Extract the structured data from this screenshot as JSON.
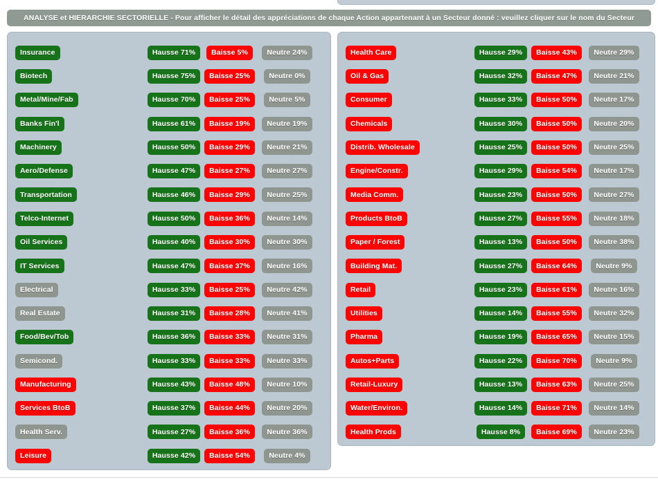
{
  "header": {
    "banner_text": "ANALYSE et HIERARCHIE SECTORIELLE - Pour afficher le détail des appréciations de chaque Action appartenant à un Secteur donné : veuillez cliquer sur le nom du Secteur"
  },
  "colors": {
    "green": "#17731a",
    "red": "#fc0404",
    "gray": "#8f9690",
    "panel_bg": "#bcc8d2",
    "header_bg": "#8e9a92",
    "page_bg": "#ffffff"
  },
  "legend": {
    "hausse_prefix": "Hausse",
    "baisse_prefix": "Baisse",
    "neutre_prefix": "Neutre"
  },
  "left_panel": {
    "rows": [
      {
        "sector": "Insurance",
        "sector_color": "green",
        "hausse": "Hausse 71%",
        "baisse": "Baisse 5%",
        "neutre": "Neutre 24%",
        "hausse_pct": 71,
        "baisse_pct": 5,
        "neutre_pct": 24
      },
      {
        "sector": "Biotech",
        "sector_color": "green",
        "hausse": "Hausse 75%",
        "baisse": "Baisse 25%",
        "neutre": "Neutre 0%",
        "hausse_pct": 75,
        "baisse_pct": 25,
        "neutre_pct": 0
      },
      {
        "sector": "Metal/Mine/Fab",
        "sector_color": "green",
        "hausse": "Hausse 70%",
        "baisse": "Baisse 25%",
        "neutre": "Neutre 5%",
        "hausse_pct": 70,
        "baisse_pct": 25,
        "neutre_pct": 5
      },
      {
        "sector": "Banks Fin'l",
        "sector_color": "green",
        "hausse": "Hausse 61%",
        "baisse": "Baisse 19%",
        "neutre": "Neutre 19%",
        "hausse_pct": 61,
        "baisse_pct": 19,
        "neutre_pct": 19
      },
      {
        "sector": "Machinery",
        "sector_color": "green",
        "hausse": "Hausse 50%",
        "baisse": "Baisse 29%",
        "neutre": "Neutre 21%",
        "hausse_pct": 50,
        "baisse_pct": 29,
        "neutre_pct": 21
      },
      {
        "sector": "Aero/Defense",
        "sector_color": "green",
        "hausse": "Hausse 47%",
        "baisse": "Baisse 27%",
        "neutre": "Neutre 27%",
        "hausse_pct": 47,
        "baisse_pct": 27,
        "neutre_pct": 27
      },
      {
        "sector": "Transportation",
        "sector_color": "green",
        "hausse": "Hausse 46%",
        "baisse": "Baisse 29%",
        "neutre": "Neutre 25%",
        "hausse_pct": 46,
        "baisse_pct": 29,
        "neutre_pct": 25
      },
      {
        "sector": "Telco-Internet",
        "sector_color": "green",
        "hausse": "Hausse 50%",
        "baisse": "Baisse 36%",
        "neutre": "Neutre 14%",
        "hausse_pct": 50,
        "baisse_pct": 36,
        "neutre_pct": 14
      },
      {
        "sector": "Oil Services",
        "sector_color": "green",
        "hausse": "Hausse 40%",
        "baisse": "Baisse 30%",
        "neutre": "Neutre 30%",
        "hausse_pct": 40,
        "baisse_pct": 30,
        "neutre_pct": 30
      },
      {
        "sector": "IT Services",
        "sector_color": "green",
        "hausse": "Hausse 47%",
        "baisse": "Baisse 37%",
        "neutre": "Neutre 16%",
        "hausse_pct": 47,
        "baisse_pct": 37,
        "neutre_pct": 16
      },
      {
        "sector": "Electrical",
        "sector_color": "gray",
        "hausse": "Hausse 33%",
        "baisse": "Baisse 25%",
        "neutre": "Neutre 42%",
        "hausse_pct": 33,
        "baisse_pct": 25,
        "neutre_pct": 42
      },
      {
        "sector": "Real Estate",
        "sector_color": "gray",
        "hausse": "Hausse 31%",
        "baisse": "Baisse 28%",
        "neutre": "Neutre 41%",
        "hausse_pct": 31,
        "baisse_pct": 28,
        "neutre_pct": 41
      },
      {
        "sector": "Food/Bev/Tob",
        "sector_color": "green",
        "hausse": "Hausse 36%",
        "baisse": "Baisse 33%",
        "neutre": "Neutre 31%",
        "hausse_pct": 36,
        "baisse_pct": 33,
        "neutre_pct": 31
      },
      {
        "sector": "Semicond.",
        "sector_color": "gray",
        "hausse": "Hausse 33%",
        "baisse": "Baisse 33%",
        "neutre": "Neutre 33%",
        "hausse_pct": 33,
        "baisse_pct": 33,
        "neutre_pct": 33
      },
      {
        "sector": "Manufacturing",
        "sector_color": "red",
        "hausse": "Hausse 43%",
        "baisse": "Baisse 48%",
        "neutre": "Neutre 10%",
        "hausse_pct": 43,
        "baisse_pct": 48,
        "neutre_pct": 10
      },
      {
        "sector": "Services BtoB",
        "sector_color": "red",
        "hausse": "Hausse 37%",
        "baisse": "Baisse 44%",
        "neutre": "Neutre 20%",
        "hausse_pct": 37,
        "baisse_pct": 44,
        "neutre_pct": 20
      },
      {
        "sector": "Health Serv.",
        "sector_color": "gray",
        "hausse": "Hausse 27%",
        "baisse": "Baisse 36%",
        "neutre": "Neutre 36%",
        "hausse_pct": 27,
        "baisse_pct": 36,
        "neutre_pct": 36
      },
      {
        "sector": "Leisure",
        "sector_color": "red",
        "hausse": "Hausse 42%",
        "baisse": "Baisse 54%",
        "neutre": "Neutre 4%",
        "hausse_pct": 42,
        "baisse_pct": 54,
        "neutre_pct": 4
      }
    ]
  },
  "right_panel": {
    "rows": [
      {
        "sector": "Health Care",
        "sector_color": "red",
        "hausse": "Hausse 29%",
        "baisse": "Baisse 43%",
        "neutre": "Neutre 29%",
        "hausse_pct": 29,
        "baisse_pct": 43,
        "neutre_pct": 29
      },
      {
        "sector": "Oil & Gas",
        "sector_color": "red",
        "hausse": "Hausse 32%",
        "baisse": "Baisse 47%",
        "neutre": "Neutre 21%",
        "hausse_pct": 32,
        "baisse_pct": 47,
        "neutre_pct": 21
      },
      {
        "sector": "Consumer",
        "sector_color": "red",
        "hausse": "Hausse 33%",
        "baisse": "Baisse 50%",
        "neutre": "Neutre 17%",
        "hausse_pct": 33,
        "baisse_pct": 50,
        "neutre_pct": 17
      },
      {
        "sector": "Chemicals",
        "sector_color": "red",
        "hausse": "Hausse 30%",
        "baisse": "Baisse 50%",
        "neutre": "Neutre 20%",
        "hausse_pct": 30,
        "baisse_pct": 50,
        "neutre_pct": 20
      },
      {
        "sector": "Distrib. Wholesale",
        "sector_color": "red",
        "hausse": "Hausse 25%",
        "baisse": "Baisse 50%",
        "neutre": "Neutre 25%",
        "hausse_pct": 25,
        "baisse_pct": 50,
        "neutre_pct": 25
      },
      {
        "sector": "Engine/Constr.",
        "sector_color": "red",
        "hausse": "Hausse 29%",
        "baisse": "Baisse 54%",
        "neutre": "Neutre 17%",
        "hausse_pct": 29,
        "baisse_pct": 54,
        "neutre_pct": 17
      },
      {
        "sector": "Media Comm.",
        "sector_color": "red",
        "hausse": "Hausse 23%",
        "baisse": "Baisse 50%",
        "neutre": "Neutre 27%",
        "hausse_pct": 23,
        "baisse_pct": 50,
        "neutre_pct": 27
      },
      {
        "sector": "Products BtoB",
        "sector_color": "red",
        "hausse": "Hausse 27%",
        "baisse": "Baisse 55%",
        "neutre": "Neutre 18%",
        "hausse_pct": 27,
        "baisse_pct": 55,
        "neutre_pct": 18
      },
      {
        "sector": "Paper / Forest",
        "sector_color": "red",
        "hausse": "Hausse 13%",
        "baisse": "Baisse 50%",
        "neutre": "Neutre 38%",
        "hausse_pct": 13,
        "baisse_pct": 50,
        "neutre_pct": 38
      },
      {
        "sector": "Building Mat.",
        "sector_color": "red",
        "hausse": "Hausse 27%",
        "baisse": "Baisse 64%",
        "neutre": "Neutre 9%",
        "hausse_pct": 27,
        "baisse_pct": 64,
        "neutre_pct": 9
      },
      {
        "sector": "Retail",
        "sector_color": "red",
        "hausse": "Hausse 23%",
        "baisse": "Baisse 61%",
        "neutre": "Neutre 16%",
        "hausse_pct": 23,
        "baisse_pct": 61,
        "neutre_pct": 16
      },
      {
        "sector": "Utilities",
        "sector_color": "red",
        "hausse": "Hausse 14%",
        "baisse": "Baisse 55%",
        "neutre": "Neutre 32%",
        "hausse_pct": 14,
        "baisse_pct": 55,
        "neutre_pct": 32
      },
      {
        "sector": "Pharma",
        "sector_color": "red",
        "hausse": "Hausse 19%",
        "baisse": "Baisse 65%",
        "neutre": "Neutre 15%",
        "hausse_pct": 19,
        "baisse_pct": 65,
        "neutre_pct": 15
      },
      {
        "sector": "Autos+Parts",
        "sector_color": "red",
        "hausse": "Hausse 22%",
        "baisse": "Baisse 70%",
        "neutre": "Neutre 9%",
        "hausse_pct": 22,
        "baisse_pct": 70,
        "neutre_pct": 9
      },
      {
        "sector": "Retail-Luxury",
        "sector_color": "red",
        "hausse": "Hausse 13%",
        "baisse": "Baisse 63%",
        "neutre": "Neutre 25%",
        "hausse_pct": 13,
        "baisse_pct": 63,
        "neutre_pct": 25
      },
      {
        "sector": "Water/Environ.",
        "sector_color": "red",
        "hausse": "Hausse 14%",
        "baisse": "Baisse 71%",
        "neutre": "Neutre 14%",
        "hausse_pct": 14,
        "baisse_pct": 71,
        "neutre_pct": 14
      },
      {
        "sector": "Health Prods",
        "sector_color": "red",
        "hausse": "Hausse 8%",
        "baisse": "Baisse 69%",
        "neutre": "Neutre 23%",
        "hausse_pct": 8,
        "baisse_pct": 69,
        "neutre_pct": 23
      }
    ]
  }
}
